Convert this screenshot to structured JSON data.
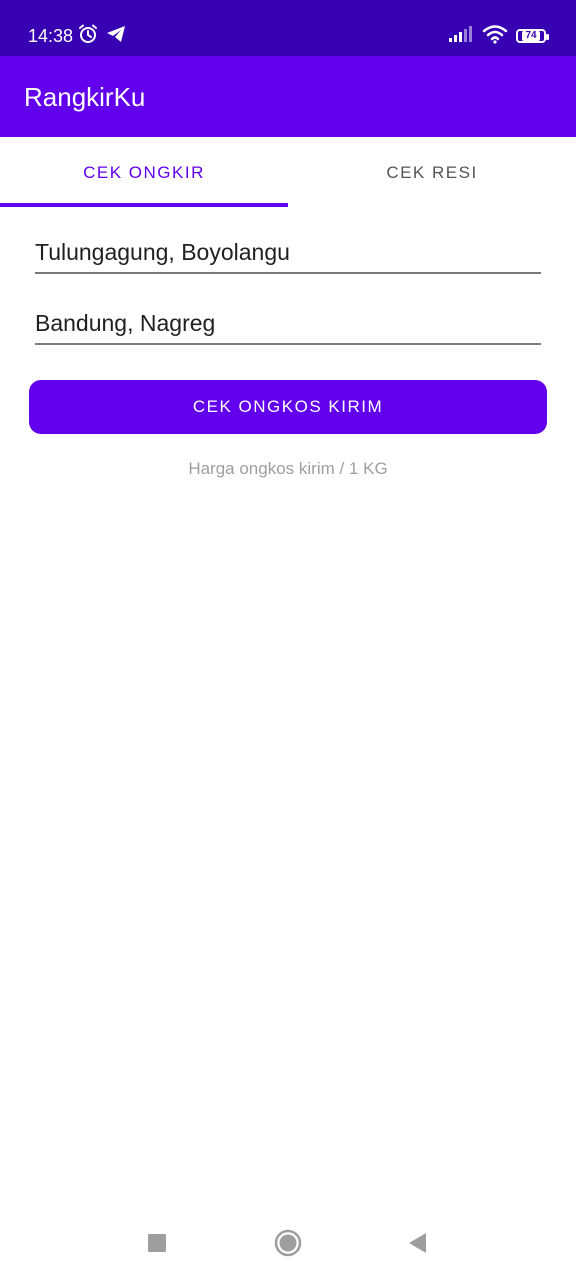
{
  "status_bar": {
    "time": "14:38",
    "battery": "74",
    "icons": [
      "alarm-icon",
      "telegram-icon",
      "signal-icon",
      "wifi-icon",
      "battery-icon"
    ]
  },
  "app_bar": {
    "title": "RangkirKu"
  },
  "tabs": [
    {
      "label": "CEK ONGKIR",
      "active": true
    },
    {
      "label": "CEK RESI",
      "active": false
    }
  ],
  "form": {
    "origin_value": "Tulungagung, Boyolangu",
    "destination_value": "Bandung, Nagreg",
    "submit_label": "CEK ONGKOS KIRIM",
    "result_hint": "Harga ongkos kirim / 1 KG"
  },
  "nav_bar": {
    "icons": [
      "recents-icon",
      "home-icon",
      "back-icon"
    ]
  },
  "colors": {
    "status_bar": "#3700b3",
    "primary": "#6200ee",
    "hint_text": "#9e9e9e"
  }
}
